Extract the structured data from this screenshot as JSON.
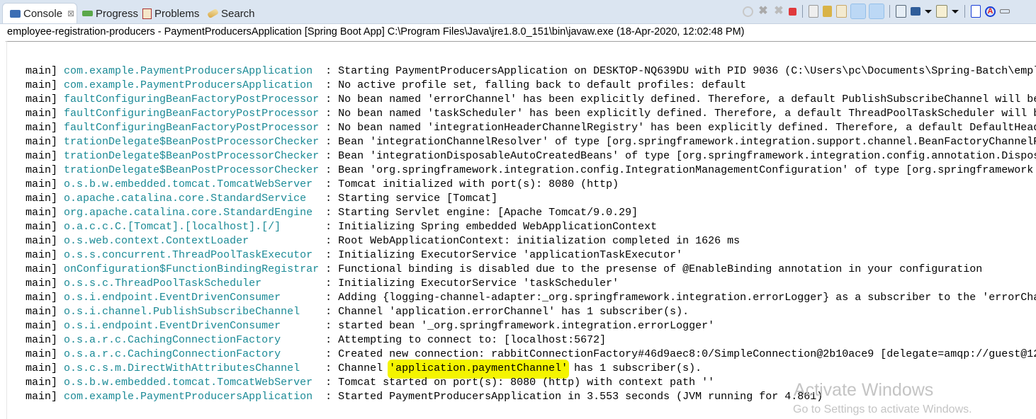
{
  "tabs": [
    {
      "label": "Console",
      "icon": "console-icon",
      "active": true
    },
    {
      "label": "Progress",
      "icon": "progress-icon"
    },
    {
      "label": "Problems",
      "icon": "problems-icon"
    },
    {
      "label": "Search",
      "icon": "search-icon"
    }
  ],
  "toolbar": [
    "refresh-icon",
    "remove-launch-icon",
    "remove-all-launches-icon",
    "terminate-icon",
    "clear-console-icon",
    "scroll-lock-icon",
    "word-wrap-icon",
    "show-on-stdout-icon",
    "show-on-stderr-icon",
    "pin-console-icon",
    "display-console-icon",
    "open-console-icon",
    "report-icon",
    "debug-icon",
    "minimize-icon"
  ],
  "process_title": "employee-registration-producers - PaymentProducersApplication [Spring Boot App] C:\\Program Files\\Java\\jre1.8.0_151\\bin\\javaw.exe (18-Apr-2020, 12:02:48 PM)",
  "log_lines": [
    {
      "thread": "main]",
      "logger": "com.example.PaymentProducersApplication",
      "message": "Starting PaymentProducersApplication on DESKTOP-NQ639DU with PID 9036 (C:\\Users\\pc\\Documents\\Spring-Batch\\empl"
    },
    {
      "thread": "main]",
      "logger": "com.example.PaymentProducersApplication",
      "message": "No active profile set, falling back to default profiles: default"
    },
    {
      "thread": "main]",
      "logger": "faultConfiguringBeanFactoryPostProcessor",
      "message": "No bean named 'errorChannel' has been explicitly defined. Therefore, a default PublishSubscribeChannel will be"
    },
    {
      "thread": "main]",
      "logger": "faultConfiguringBeanFactoryPostProcessor",
      "message": "No bean named 'taskScheduler' has been explicitly defined. Therefore, a default ThreadPoolTaskScheduler will b"
    },
    {
      "thread": "main]",
      "logger": "faultConfiguringBeanFactoryPostProcessor",
      "message": "No bean named 'integrationHeaderChannelRegistry' has been explicitly defined. Therefore, a default DefaultHead"
    },
    {
      "thread": "main]",
      "logger": "trationDelegate$BeanPostProcessorChecker",
      "message": "Bean 'integrationChannelResolver' of type [org.springframework.integration.support.channel.BeanFactoryChannelR"
    },
    {
      "thread": "main]",
      "logger": "trationDelegate$BeanPostProcessorChecker",
      "message": "Bean 'integrationDisposableAutoCreatedBeans' of type [org.springframework.integration.config.annotation.Dispos"
    },
    {
      "thread": "main]",
      "logger": "trationDelegate$BeanPostProcessorChecker",
      "message": "Bean 'org.springframework.integration.config.IntegrationManagementConfiguration' of type [org.springframework"
    },
    {
      "thread": "main]",
      "logger": "o.s.b.w.embedded.tomcat.TomcatWebServer",
      "message": "Tomcat initialized with port(s): 8080 (http)"
    },
    {
      "thread": "main]",
      "logger": "o.apache.catalina.core.StandardService",
      "message": "Starting service [Tomcat]"
    },
    {
      "thread": "main]",
      "logger": "org.apache.catalina.core.StandardEngine",
      "message": "Starting Servlet engine: [Apache Tomcat/9.0.29]"
    },
    {
      "thread": "main]",
      "logger": "o.a.c.c.C.[Tomcat].[localhost].[/]",
      "message": "Initializing Spring embedded WebApplicationContext"
    },
    {
      "thread": "main]",
      "logger": "o.s.web.context.ContextLoader",
      "message": "Root WebApplicationContext: initialization completed in 1626 ms"
    },
    {
      "thread": "main]",
      "logger": "o.s.s.concurrent.ThreadPoolTaskExecutor",
      "message": "Initializing ExecutorService 'applicationTaskExecutor'"
    },
    {
      "thread": "main]",
      "logger": "onConfiguration$FunctionBindingRegistrar",
      "message": "Functional binding is disabled due to the presense of @EnableBinding annotation in your configuration"
    },
    {
      "thread": "main]",
      "logger": "o.s.s.c.ThreadPoolTaskScheduler",
      "message": "Initializing ExecutorService 'taskScheduler'"
    },
    {
      "thread": "main]",
      "logger": "o.s.i.endpoint.EventDrivenConsumer",
      "message": "Adding {logging-channel-adapter:_org.springframework.integration.errorLogger} as a subscriber to the 'errorCha"
    },
    {
      "thread": "main]",
      "logger": "o.s.i.channel.PublishSubscribeChannel",
      "message": "Channel 'application.errorChannel' has 1 subscriber(s)."
    },
    {
      "thread": "main]",
      "logger": "o.s.i.endpoint.EventDrivenConsumer",
      "message": "started bean '_org.springframework.integration.errorLogger'"
    },
    {
      "thread": "main]",
      "logger": "o.s.a.r.c.CachingConnectionFactory",
      "message": "Attempting to connect to: [localhost:5672]"
    },
    {
      "thread": "main]",
      "logger": "o.s.a.r.c.CachingConnectionFactory",
      "message": "Created new connection: rabbitConnectionFactory#46d9aec8:0/SimpleConnection@2b10ace9 [delegate=amqp://guest@12"
    },
    {
      "thread": "main]",
      "logger": "o.s.c.s.m.DirectWithAttributesChannel",
      "message": "Channel 'application.paymentChannel' has 1 subscriber(s).",
      "highlight": "'application.paymentChannel'"
    },
    {
      "thread": "main]",
      "logger": "o.s.b.w.embedded.tomcat.TomcatWebServer",
      "message": "Tomcat started on port(s): 8080 (http) with context path ''"
    },
    {
      "thread": "main]",
      "logger": "com.example.PaymentProducersApplication",
      "message": "Started PaymentProducersApplication in 3.553 seconds (JVM running for 4.861)"
    }
  ],
  "watermark": {
    "title": "Activate Windows",
    "subtitle": "Go to Settings to activate Windows."
  },
  "colors": {
    "logger": "#1b8a96",
    "highlight": "#f4f400",
    "tabbar": "#dbe5f1"
  }
}
